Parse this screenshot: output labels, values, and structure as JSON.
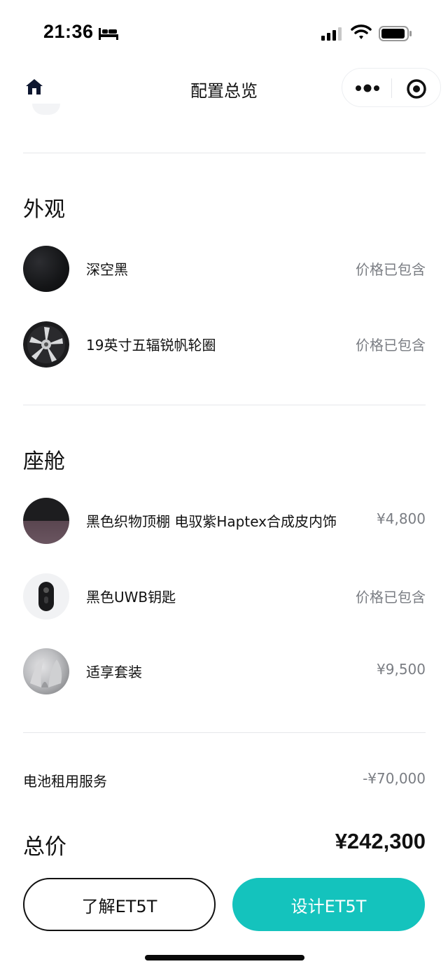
{
  "status_bar": {
    "time": "21:36",
    "icons": [
      "bed-icon",
      "signal-icon",
      "wifi-icon",
      "battery-icon"
    ]
  },
  "nav": {
    "title": "配置总览",
    "icons": [
      "home-icon",
      "more-icon",
      "target-icon"
    ]
  },
  "exterior": {
    "title": "外观",
    "items": [
      {
        "name": "深空黑",
        "price": "价格已包含"
      },
      {
        "name": "19英寸五辐锐帆轮圈",
        "price": "价格已包含"
      }
    ]
  },
  "cabin": {
    "title": "座舱",
    "items": [
      {
        "name": "黑色织物顶棚 电驭紫Haptex合成皮内饰",
        "price": "¥4,800"
      },
      {
        "name": "黑色UWB钥匙",
        "price": "价格已包含"
      },
      {
        "name": "适享套装",
        "price": "¥9,500"
      }
    ]
  },
  "battery_service": {
    "label": "电池租用服务",
    "value": "-¥70,000"
  },
  "total": {
    "label": "总价",
    "value": "¥242,300"
  },
  "buttons": {
    "learn": "了解ET5T",
    "design": "设计ET5T"
  },
  "colors": {
    "accent": "#14c3bd",
    "muted_text": "#7a7d83"
  }
}
